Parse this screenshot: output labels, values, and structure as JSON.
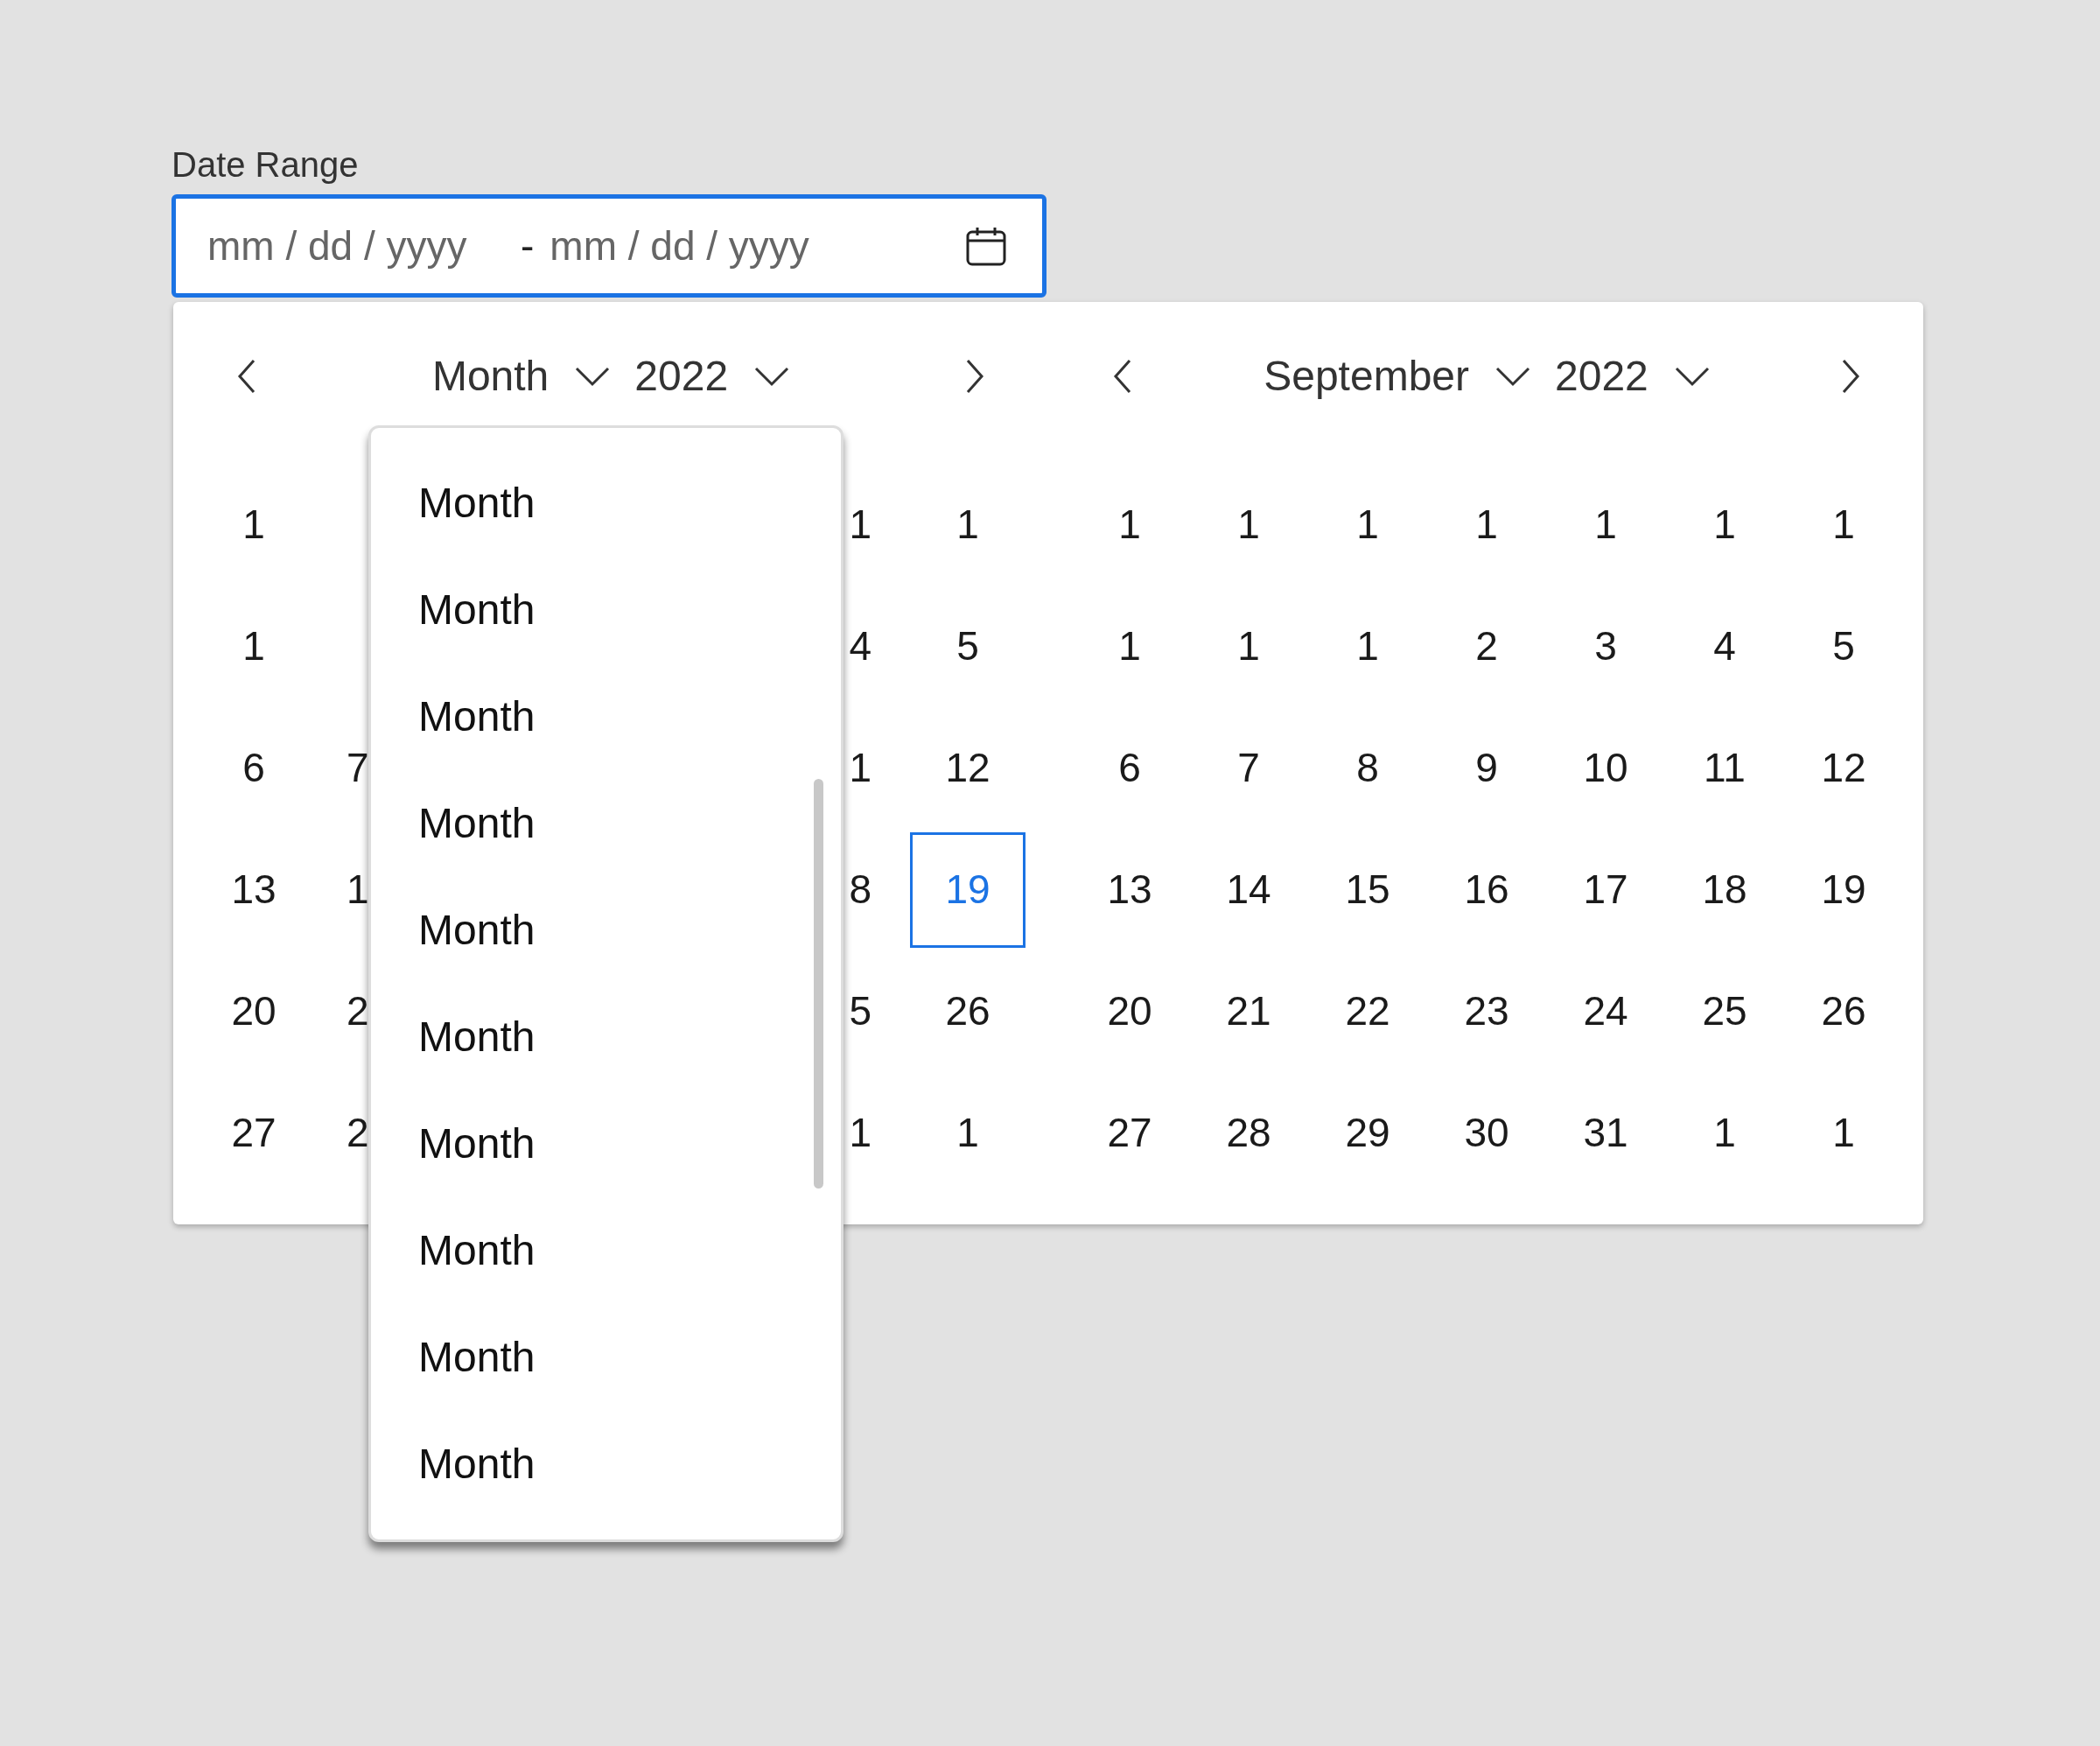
{
  "field": {
    "label": "Date Range",
    "start_placeholder": "mm / dd / yyyy",
    "separator": "-",
    "end_placeholder": "mm / dd / yyyy",
    "focused": true
  },
  "calendars": [
    {
      "month": "Month",
      "year": "2022",
      "month_menu": {
        "expanded": true,
        "options": [
          "Month",
          "Month",
          "Month",
          "Month",
          "Month",
          "Month",
          "Month",
          "Month",
          "Month",
          "Month"
        ]
      },
      "rows": [
        {
          "leading": [
            {
              "day": "1",
              "selected": false
            }
          ],
          "trailing": [
            {
              "day": "1",
              "selected": false
            },
            {
              "day": "1",
              "selected": false
            }
          ]
        },
        {
          "leading": [
            {
              "day": "1",
              "selected": false
            }
          ],
          "trailing": [
            {
              "day": "4",
              "selected": false
            },
            {
              "day": "5",
              "selected": false
            }
          ]
        },
        {
          "leading": [
            {
              "day": "6",
              "selected": false
            },
            {
              "day": "7",
              "selected": false
            }
          ],
          "trailing": [
            {
              "day": "1",
              "selected": false
            },
            {
              "day": "12",
              "selected": false
            }
          ]
        },
        {
          "leading": [
            {
              "day": "13",
              "selected": false
            },
            {
              "day": "1",
              "selected": false
            }
          ],
          "trailing": [
            {
              "day": "8",
              "selected": false
            },
            {
              "day": "19",
              "selected": true
            }
          ]
        },
        {
          "leading": [
            {
              "day": "20",
              "selected": false
            },
            {
              "day": "2",
              "selected": false
            }
          ],
          "trailing": [
            {
              "day": "5",
              "selected": false
            },
            {
              "day": "26",
              "selected": false
            }
          ]
        },
        {
          "leading": [
            {
              "day": "27",
              "selected": false
            },
            {
              "day": "2",
              "selected": false
            }
          ],
          "trailing": [
            {
              "day": "1",
              "selected": false
            },
            {
              "day": "1",
              "selected": false
            }
          ]
        }
      ]
    },
    {
      "month": "September",
      "year": "2022",
      "rows": [
        {
          "days": [
            {
              "day": "1",
              "selected": false
            },
            {
              "day": "1",
              "selected": false
            },
            {
              "day": "1",
              "selected": false
            },
            {
              "day": "1",
              "selected": false
            },
            {
              "day": "1",
              "selected": false
            },
            {
              "day": "1",
              "selected": false
            },
            {
              "day": "1",
              "selected": false
            }
          ]
        },
        {
          "days": [
            {
              "day": "1",
              "selected": false
            },
            {
              "day": "1",
              "selected": false
            },
            {
              "day": "1",
              "selected": false
            },
            {
              "day": "2",
              "selected": false
            },
            {
              "day": "3",
              "selected": false
            },
            {
              "day": "4",
              "selected": false
            },
            {
              "day": "5",
              "selected": false
            }
          ]
        },
        {
          "days": [
            {
              "day": "6",
              "selected": false
            },
            {
              "day": "7",
              "selected": false
            },
            {
              "day": "8",
              "selected": false
            },
            {
              "day": "9",
              "selected": false
            },
            {
              "day": "10",
              "selected": false
            },
            {
              "day": "11",
              "selected": false
            },
            {
              "day": "12",
              "selected": false
            }
          ]
        },
        {
          "days": [
            {
              "day": "13",
              "selected": false
            },
            {
              "day": "14",
              "selected": false
            },
            {
              "day": "15",
              "selected": false
            },
            {
              "day": "16",
              "selected": false
            },
            {
              "day": "17",
              "selected": false
            },
            {
              "day": "18",
              "selected": false
            },
            {
              "day": "19",
              "selected": false
            }
          ]
        },
        {
          "days": [
            {
              "day": "20",
              "selected": false
            },
            {
              "day": "21",
              "selected": false
            },
            {
              "day": "22",
              "selected": false
            },
            {
              "day": "23",
              "selected": false
            },
            {
              "day": "24",
              "selected": false
            },
            {
              "day": "25",
              "selected": false
            },
            {
              "day": "26",
              "selected": false
            }
          ]
        },
        {
          "days": [
            {
              "day": "27",
              "selected": false
            },
            {
              "day": "28",
              "selected": false
            },
            {
              "day": "29",
              "selected": false
            },
            {
              "day": "30",
              "selected": false
            },
            {
              "day": "31",
              "selected": false
            },
            {
              "day": "1",
              "selected": false
            },
            {
              "day": "1",
              "selected": false
            }
          ]
        }
      ]
    }
  ]
}
